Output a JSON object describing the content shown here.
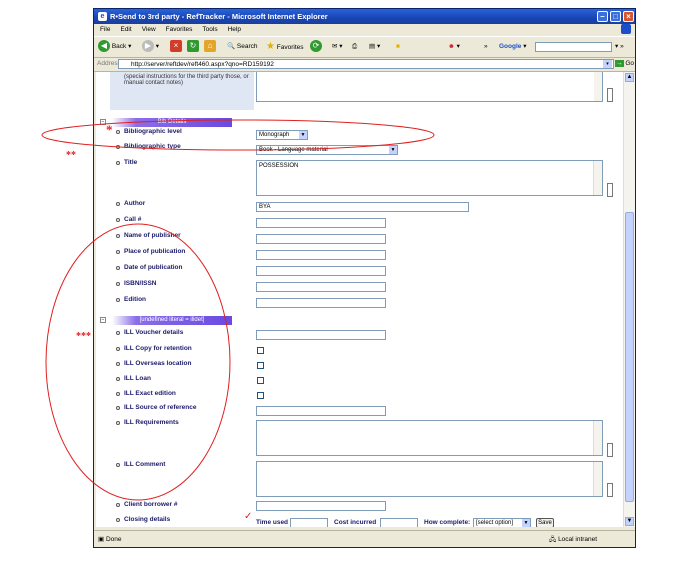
{
  "window": {
    "title": "R•Send to 3rd party - RefTracker - Microsoft Internet Explorer"
  },
  "menu": [
    "File",
    "Edit",
    "View",
    "Favorites",
    "Tools",
    "Help"
  ],
  "toolbar": {
    "back": "Back",
    "search": "Search",
    "favorites": "Favorites",
    "google": "Google"
  },
  "address": {
    "label": "Address",
    "url": "http://server/reftdev/reft460.aspx?qno=RD159192",
    "go": "Go"
  },
  "top_note": "(special instructions for the third party those, or manual contact notes)",
  "bib_section": {
    "header": "Bib Details",
    "level_label": "Bibliographic level",
    "level_value": "Monograph",
    "type_label": "Bibliographic type",
    "type_value": "Book - Language material",
    "title_label": "Title",
    "title_value": "POSSESSION",
    "author_label": "Author",
    "author_value": "BYA",
    "call_label": "Call #",
    "publisher_label": "Name of publisher",
    "place_label": "Place of publication",
    "date_label": "Date of publication",
    "isbn_label": "ISBN/ISSN",
    "edition_label": "Edition"
  },
  "ill_section": {
    "header": "[undefined literal = illdet]",
    "voucher_label": "ILL Voucher details",
    "copy_label": "ILL Copy for retention",
    "overseas_label": "ILL Overseas location",
    "loan_label": "ILL Loan",
    "exact_label": "ILL Exact edition",
    "source_label": "ILL Source of reference",
    "requirements_label": "ILL Requirements",
    "comment_label": "ILL Comment",
    "client_label": "Client borrower #",
    "closing_label": "Closing details"
  },
  "closing": {
    "time_label": "Time used",
    "cost_label": "Cost incurred",
    "complete_label": "How complete:",
    "complete_value": "[select option]",
    "save_label": "Save"
  },
  "status": {
    "left": "Done",
    "right": "Local intranet"
  },
  "annotations": {
    "star1": "*",
    "star2": "**",
    "star3": "***",
    "color": "#e02020"
  }
}
